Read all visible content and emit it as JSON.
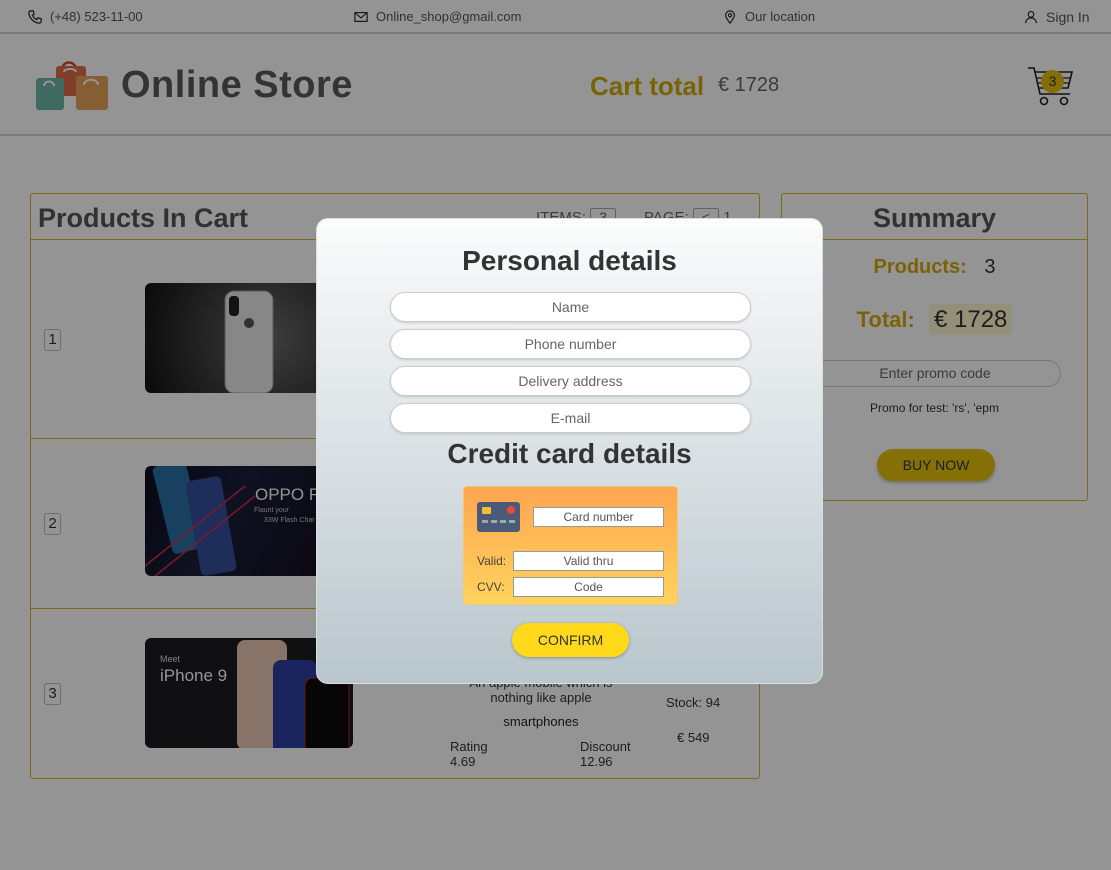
{
  "topbar": {
    "phone": "(+48) 523-11-00",
    "email": "Online_shop@gmail.com",
    "location": "Our location",
    "sign_in": "Sign In"
  },
  "header": {
    "brand": "Online Store",
    "cart_total_label": "Cart total",
    "cart_total_value": "€ 1728",
    "cart_count": "3"
  },
  "products_panel": {
    "title": "Products In Cart",
    "items_label": "ITEMS:",
    "items_value": "3",
    "page_label": "PAGE:",
    "page_prev": "<",
    "page_value": "1",
    "page_next": ">",
    "rows": [
      {
        "index": "1",
        "image_text": ""
      },
      {
        "index": "2",
        "image_text": "OPPO F",
        "image_sub1": "Flaunt your",
        "image_sub2": "33W Flash Char"
      },
      {
        "index": "3",
        "image_meet": "Meet",
        "image_text": "iPhone 9",
        "description": "An apple mobile which is nothing like apple",
        "category": "smartphones",
        "rating_label": "Rating",
        "rating": "4.69",
        "discount_label": "Discount",
        "discount": "12.96",
        "stock_label": "Stock:",
        "stock": "94",
        "price": "€ 549"
      }
    ]
  },
  "summary": {
    "title": "Summary",
    "products_label": "Products:",
    "products_value": "3",
    "total_label": "Total:",
    "total_value": "€ 1728",
    "promo_placeholder": "Enter promo code",
    "promo_hint": "Promo for test: 'rs', 'epm",
    "buy_label": "BUY NOW"
  },
  "modal": {
    "personal_title": "Personal details",
    "name_placeholder": "Name",
    "phone_placeholder": "Phone number",
    "address_placeholder": "Delivery address",
    "email_placeholder": "E-mail",
    "card_title": "Credit card details",
    "card_number_placeholder": "Card number",
    "valid_label": "Valid:",
    "valid_placeholder": "Valid thru",
    "cvv_label": "CVV:",
    "cvv_placeholder": "Code",
    "confirm_label": "CONFIRM"
  },
  "colors": {
    "accent": "#d2a90c",
    "button": "#e6c20f",
    "confirm": "#ffd91a"
  }
}
